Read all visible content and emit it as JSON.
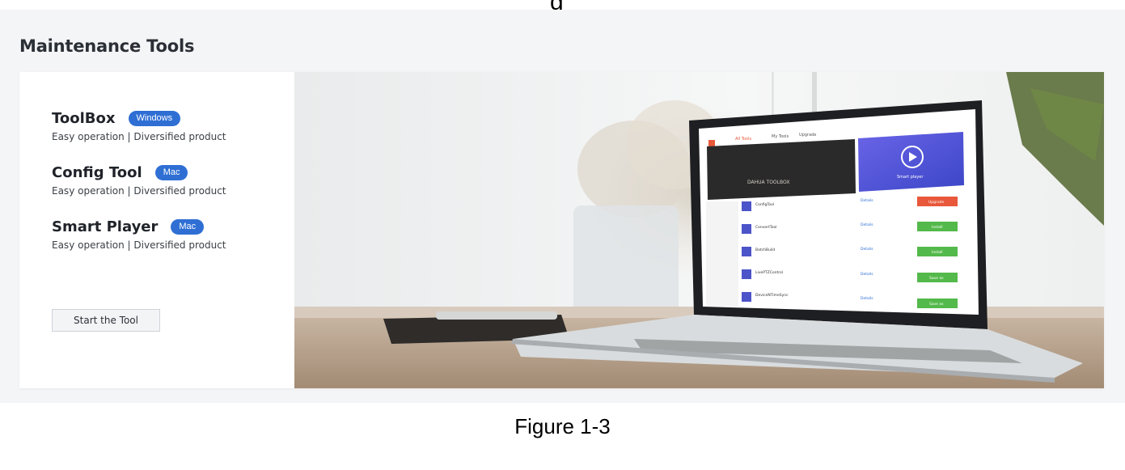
{
  "top_partial_text": "g",
  "section_title": "Maintenance Tools",
  "tools": [
    {
      "name": "ToolBox",
      "platform": "Windows",
      "description": "Easy operation | Diversified product"
    },
    {
      "name": "Config Tool",
      "platform": "Mac",
      "description": "Easy operation | Diversified product"
    },
    {
      "name": "Smart Player",
      "platform": "Mac",
      "description": "Easy operation | Diversified product"
    }
  ],
  "start_button_label": "Start the Tool",
  "banner": {
    "window_tabs": [
      "All Tools",
      "My Tools",
      "Upgrade"
    ],
    "hero_brand": "DAHUA TOOLBOX",
    "hero_side": "Smart player",
    "app_rows": [
      {
        "name": "ConfigTool",
        "details": "Details",
        "action": "Upgrade"
      },
      {
        "name": "ConvertTool",
        "details": "Details",
        "action": "Install"
      },
      {
        "name": "BatchBuild",
        "details": "Details",
        "action": "Install"
      },
      {
        "name": "LivePTZControl",
        "details": "Details",
        "action": "Save as"
      },
      {
        "name": "DeviceNTimeSync",
        "details": "Details",
        "action": "Save as"
      }
    ],
    "colors": {
      "upgrade": "#e8583a",
      "install": "#53b94a",
      "accent": "#2f6fd4"
    }
  },
  "figure_caption": "Figure 1-3"
}
